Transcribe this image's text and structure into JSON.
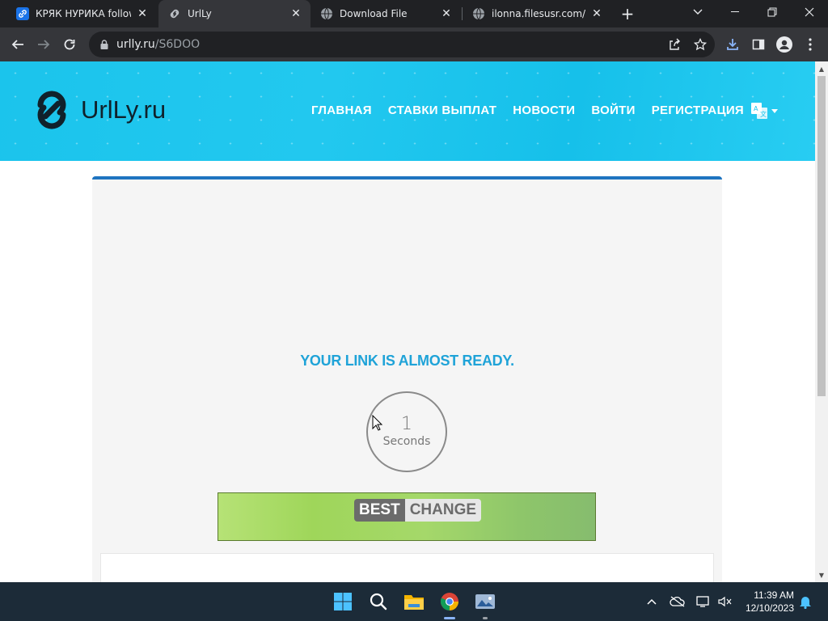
{
  "browser": {
    "tabs": [
      {
        "title": "КРЯК НУРИКА follow t",
        "favicon": "link-icon-blue",
        "active": false
      },
      {
        "title": "UrlLy",
        "favicon": "urlly-chain-icon",
        "active": true
      },
      {
        "title": "Download File",
        "favicon": "globe-icon",
        "active": false
      },
      {
        "title": "ilonna.filesusr.com/htm",
        "favicon": "globe-icon",
        "active": false
      }
    ],
    "address": {
      "host": "urlly.ru",
      "path": "/S6DOO"
    }
  },
  "site": {
    "logo_text": "UrlLy.ru",
    "nav": [
      {
        "label": "ГЛАВНАЯ"
      },
      {
        "label": "СТАВКИ ВЫПЛАТ"
      },
      {
        "label": "НОВОСТИ"
      },
      {
        "label": "ВОЙТИ"
      },
      {
        "label": "РЕГИСТРАЦИЯ"
      }
    ],
    "language_icon": "translate-icon",
    "header_color": "#1bc4ec",
    "card_accent": "#1e74c0"
  },
  "main": {
    "ready_text": "YOUR LINK IS ALMOST READY.",
    "countdown": {
      "number": "1",
      "unit": "Seconds"
    },
    "banner": {
      "left": "BEST",
      "right": "CHANGE"
    }
  },
  "taskbar": {
    "time": "11:39 AM",
    "date": "12/10/2023"
  }
}
